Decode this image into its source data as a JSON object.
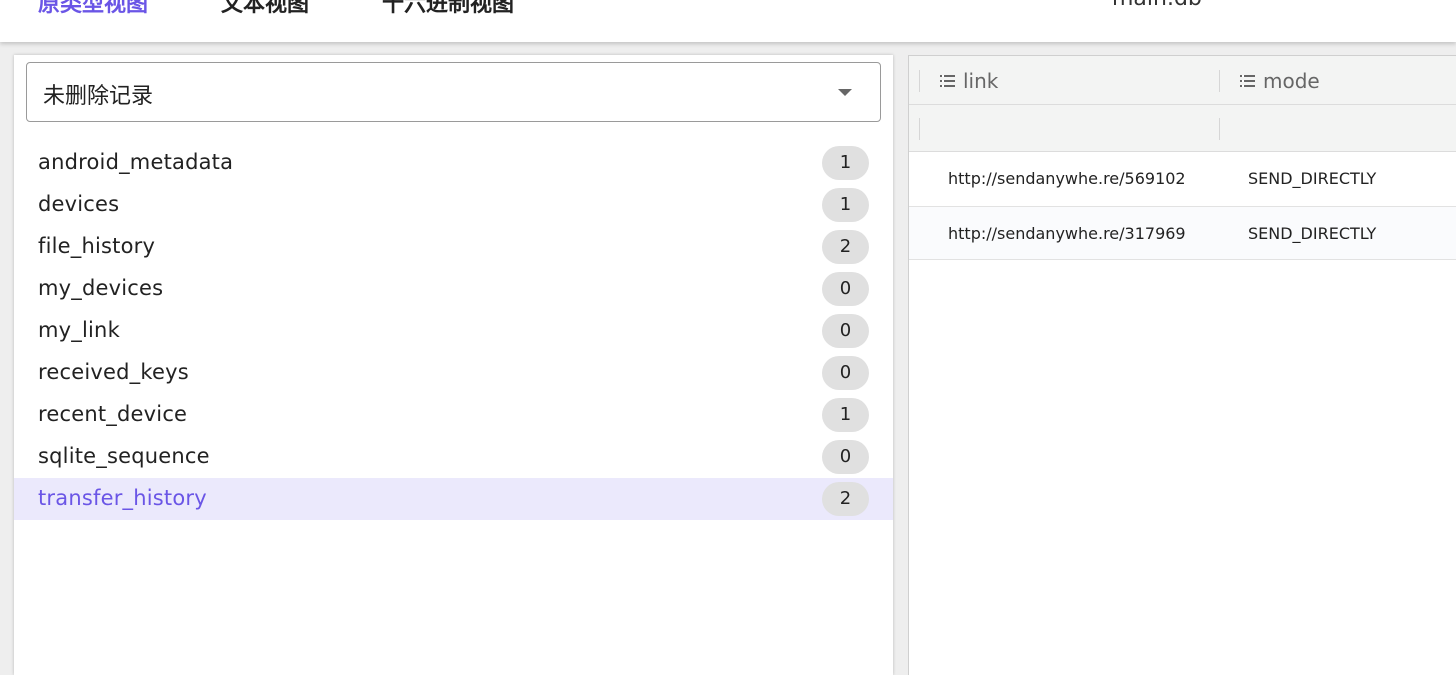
{
  "top_bar": {
    "tabs": [
      {
        "label": "原类型视图",
        "active": true
      },
      {
        "label": "文本视图",
        "active": false
      },
      {
        "label": "十六进制视图",
        "active": false
      }
    ],
    "filename": "main.db"
  },
  "record_filter": {
    "selected": "未删除记录"
  },
  "tables": [
    {
      "name": "android_metadata",
      "count": "1"
    },
    {
      "name": "devices",
      "count": "1"
    },
    {
      "name": "file_history",
      "count": "2"
    },
    {
      "name": "my_devices",
      "count": "0"
    },
    {
      "name": "my_link",
      "count": "0"
    },
    {
      "name": "received_keys",
      "count": "0"
    },
    {
      "name": "recent_device",
      "count": "1"
    },
    {
      "name": "sqlite_sequence",
      "count": "0"
    },
    {
      "name": "transfer_history",
      "count": "2"
    }
  ],
  "selected_table_index": 8,
  "grid": {
    "columns": [
      {
        "label": "link",
        "icon": "list-icon"
      },
      {
        "label": "mode",
        "icon": "list-icon"
      }
    ],
    "rows": [
      [
        "http://sendanywhe.re/569102",
        "SEND_DIRECTLY"
      ],
      [
        "http://sendanywhe.re/317969",
        "SEND_DIRECTLY"
      ]
    ]
  },
  "colors": {
    "accent": "#6a55e6",
    "selected_row_bg": "#ebe9fc",
    "badge_bg": "#e0e0e0"
  }
}
